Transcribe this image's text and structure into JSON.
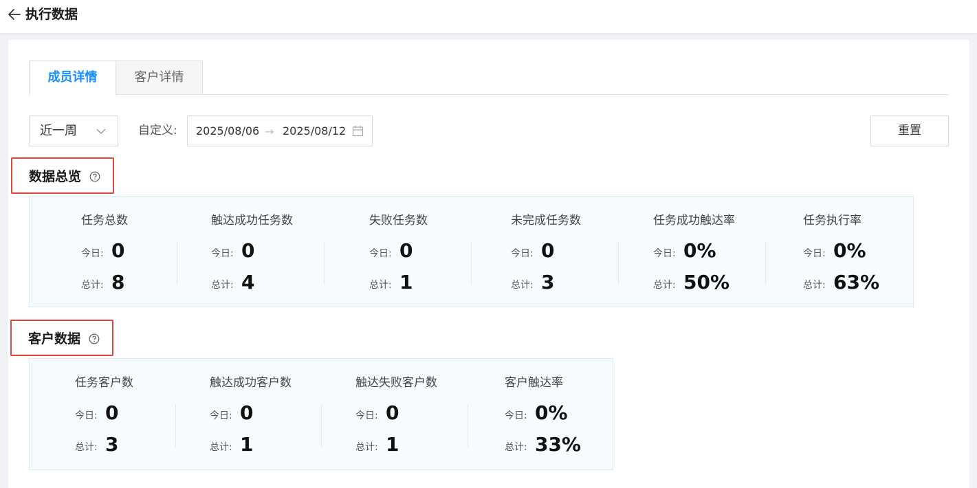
{
  "header": {
    "title": "执行数据"
  },
  "tabs": [
    {
      "label": "成员详情"
    },
    {
      "label": "客户详情"
    }
  ],
  "filters": {
    "period": "近一周",
    "custom_label": "自定义:",
    "date_start": "2025/08/06",
    "date_arrow": "→",
    "date_end": "2025/08/12",
    "reset": "重置"
  },
  "overview": {
    "title": "数据总览",
    "stats": [
      {
        "label": "任务总数",
        "today_label": "今日:",
        "today": "0",
        "total_label": "总计:",
        "total": "8"
      },
      {
        "label": "触达成功任务数",
        "today_label": "今日:",
        "today": "0",
        "total_label": "总计:",
        "total": "4"
      },
      {
        "label": "失败任务数",
        "today_label": "今日:",
        "today": "0",
        "total_label": "总计:",
        "total": "1"
      },
      {
        "label": "未完成任务数",
        "today_label": "今日:",
        "today": "0",
        "total_label": "总计:",
        "total": "3"
      },
      {
        "label": "任务成功触达率",
        "today_label": "今日:",
        "today": "0%",
        "total_label": "总计:",
        "total": "50%"
      },
      {
        "label": "任务执行率",
        "today_label": "今日:",
        "today": "0%",
        "total_label": "总计:",
        "total": "63%"
      }
    ]
  },
  "customer": {
    "title": "客户数据",
    "stats": [
      {
        "label": "任务客户数",
        "today_label": "今日:",
        "today": "0",
        "total_label": "总计:",
        "total": "3"
      },
      {
        "label": "触达成功客户数",
        "today_label": "今日:",
        "today": "0",
        "total_label": "总计:",
        "total": "1"
      },
      {
        "label": "触达失败客户数",
        "today_label": "今日:",
        "today": "0",
        "total_label": "总计:",
        "total": "1"
      },
      {
        "label": "客户触达率",
        "today_label": "今日:",
        "today": "0%",
        "total_label": "总计:",
        "total": "33%"
      }
    ]
  },
  "colors": {
    "accent": "#1890ff",
    "highlight_border": "#e0463c",
    "panel_bg": "#f6fbfe"
  },
  "icons": {
    "back": "arrow-left-icon",
    "dropdown": "chevron-down-icon",
    "calendar": "calendar-icon",
    "help": "question-circle-icon"
  }
}
